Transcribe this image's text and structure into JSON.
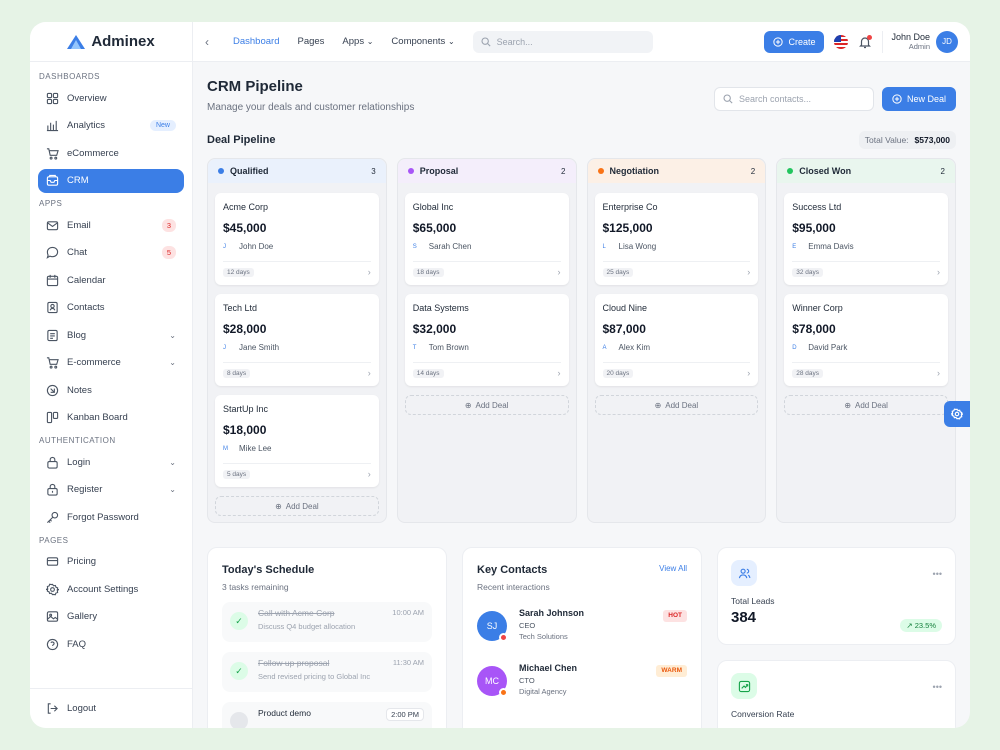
{
  "app": {
    "name": "Adminex"
  },
  "sidebar": {
    "sections": [
      "Dashboards",
      "Apps",
      "Authentication",
      "Pages"
    ],
    "dashboards": [
      {
        "label": "Overview"
      },
      {
        "label": "Analytics",
        "badge": "New"
      },
      {
        "label": "eCommerce"
      },
      {
        "label": "CRM"
      }
    ],
    "apps": [
      {
        "label": "Email",
        "badge": "3"
      },
      {
        "label": "Chat",
        "badge": "5"
      },
      {
        "label": "Calendar"
      },
      {
        "label": "Contacts"
      },
      {
        "label": "Blog"
      },
      {
        "label": "E-commerce"
      },
      {
        "label": "Notes"
      },
      {
        "label": "Kanban Board"
      }
    ],
    "auth": [
      {
        "label": "Login"
      },
      {
        "label": "Register"
      },
      {
        "label": "Forgot Password"
      }
    ],
    "pages": [
      {
        "label": "Pricing"
      },
      {
        "label": "Account Settings"
      },
      {
        "label": "Gallery"
      },
      {
        "label": "FAQ"
      }
    ],
    "logout": "Logout"
  },
  "topbar": {
    "nav": [
      "Dashboard",
      "Pages",
      "Apps",
      "Components"
    ],
    "search_placeholder": "Search...",
    "create_label": "Create",
    "user_name": "John Doe",
    "user_role": "Admin",
    "user_initials": "JD"
  },
  "page": {
    "title": "CRM Pipeline",
    "subtitle": "Manage your deals and customer relationships",
    "contact_search_placeholder": "Search contacts...",
    "new_deal_label": "New Deal"
  },
  "pipeline": {
    "title": "Deal Pipeline",
    "total_label": "Total Value:",
    "total_value": "$573,000",
    "add_label": "Add Deal",
    "columns": [
      {
        "name": "Qualified",
        "count": "3",
        "color": "#3b7ee6",
        "bg": "#eaf1fc",
        "deals": [
          {
            "company": "Acme Corp",
            "amount": "$45,000",
            "initial": "J",
            "owner": "John Doe",
            "days": "12 days"
          },
          {
            "company": "Tech Ltd",
            "amount": "$28,000",
            "initial": "J",
            "owner": "Jane Smith",
            "days": "8 days"
          },
          {
            "company": "StartUp Inc",
            "amount": "$18,000",
            "initial": "M",
            "owner": "Mike Lee",
            "days": "5 days"
          }
        ]
      },
      {
        "name": "Proposal",
        "count": "2",
        "color": "#a855f7",
        "bg": "#f4eefb",
        "deals": [
          {
            "company": "Global Inc",
            "amount": "$65,000",
            "initial": "S",
            "owner": "Sarah Chen",
            "days": "18 days"
          },
          {
            "company": "Data Systems",
            "amount": "$32,000",
            "initial": "T",
            "owner": "Tom Brown",
            "days": "14 days"
          }
        ]
      },
      {
        "name": "Negotiation",
        "count": "2",
        "color": "#f97316",
        "bg": "#fcf0e6",
        "deals": [
          {
            "company": "Enterprise Co",
            "amount": "$125,000",
            "initial": "L",
            "owner": "Lisa Wong",
            "days": "25 days"
          },
          {
            "company": "Cloud Nine",
            "amount": "$87,000",
            "initial": "A",
            "owner": "Alex Kim",
            "days": "20 days"
          }
        ]
      },
      {
        "name": "Closed Won",
        "count": "2",
        "color": "#22c55e",
        "bg": "#e9f6ee",
        "deals": [
          {
            "company": "Success Ltd",
            "amount": "$95,000",
            "initial": "E",
            "owner": "Emma Davis",
            "days": "32 days"
          },
          {
            "company": "Winner Corp",
            "amount": "$78,000",
            "initial": "D",
            "owner": "David Park",
            "days": "28 days"
          }
        ]
      }
    ]
  },
  "schedule": {
    "title": "Today's Schedule",
    "subtitle": "3 tasks remaining",
    "tasks": [
      {
        "title": "Call with Acme Corp",
        "desc": "Discuss Q4 budget allocation",
        "time": "10:00 AM"
      },
      {
        "title": "Follow up proposal",
        "desc": "Send revised pricing to Global Inc",
        "time": "11:30 AM"
      },
      {
        "title": "Product demo",
        "desc": "",
        "time": "2:00 PM"
      }
    ]
  },
  "contacts": {
    "title": "Key Contacts",
    "subtitle": "Recent interactions",
    "view_all": "View All",
    "items": [
      {
        "initials": "SJ",
        "name": "Sarah Johnson",
        "role": "CEO",
        "company": "Tech Solutions",
        "tag": "HOT",
        "color": "#3b7ee6"
      },
      {
        "initials": "MC",
        "name": "Michael Chen",
        "role": "CTO",
        "company": "Digital Agency",
        "tag": "WARM",
        "color": "#a855f7"
      }
    ]
  },
  "stats": [
    {
      "label": "Total Leads",
      "value": "384",
      "trend": "23.5%"
    },
    {
      "label": "Conversion Rate"
    }
  ]
}
